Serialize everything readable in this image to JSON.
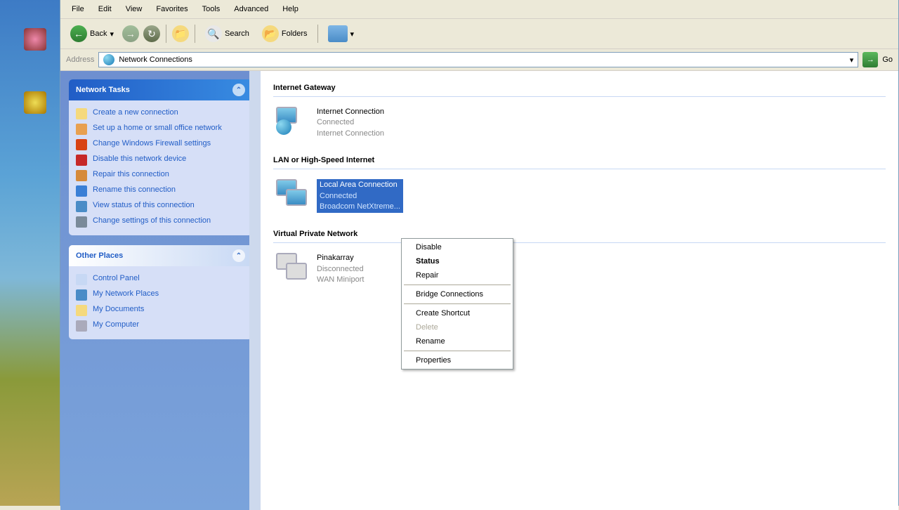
{
  "menu": {
    "file": "File",
    "edit": "Edit",
    "view": "View",
    "favorites": "Favorites",
    "tools": "Tools",
    "advanced": "Advanced",
    "help": "Help"
  },
  "toolbar": {
    "back": "Back",
    "search": "Search",
    "folders": "Folders"
  },
  "address": {
    "label": "Address",
    "value": "Network Connections",
    "go": "Go"
  },
  "sidebar": {
    "tasks_header": "Network Tasks",
    "tasks": [
      {
        "label": "Create a new connection"
      },
      {
        "label": "Set up a home or small office network"
      },
      {
        "label": "Change Windows Firewall settings"
      },
      {
        "label": "Disable this network device"
      },
      {
        "label": "Repair this connection"
      },
      {
        "label": "Rename this connection"
      },
      {
        "label": "View status of this connection"
      },
      {
        "label": "Change settings of this connection"
      }
    ],
    "places_header": "Other Places",
    "places": [
      {
        "label": "Control Panel"
      },
      {
        "label": "My Network Places"
      },
      {
        "label": "My Documents"
      },
      {
        "label": "My Computer"
      }
    ]
  },
  "groups": {
    "gateway": {
      "header": "Internet Gateway",
      "item": {
        "name": "Internet Connection",
        "status": "Connected",
        "device": "Internet Connection"
      }
    },
    "lan": {
      "header": "LAN or High-Speed Internet",
      "item": {
        "name": "Local Area Connection",
        "status": "Connected",
        "device": "Broadcom NetXtreme..."
      }
    },
    "vpn": {
      "header": "Virtual Private Network",
      "item": {
        "name": "Pinakarray",
        "status": "Disconnected",
        "device": "WAN Miniport"
      }
    }
  },
  "context": {
    "disable": "Disable",
    "status": "Status",
    "repair": "Repair",
    "bridge": "Bridge Connections",
    "shortcut": "Create Shortcut",
    "delete": "Delete",
    "rename": "Rename",
    "properties": "Properties"
  }
}
